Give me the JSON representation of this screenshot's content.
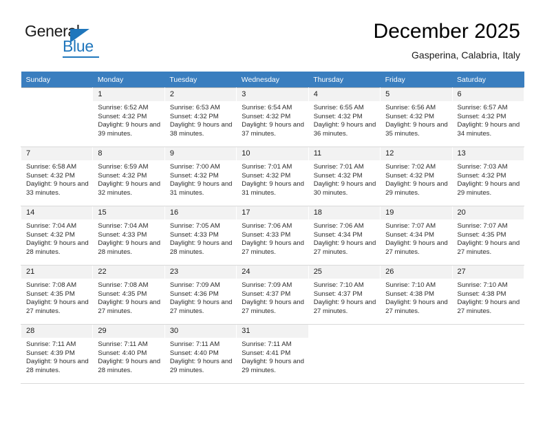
{
  "logo": {
    "line1": "General",
    "line2": "Blue",
    "accent_color": "#1f76bc"
  },
  "header": {
    "title": "December 2025",
    "subtitle": "Gasperina, Calabria, Italy"
  },
  "calendar": {
    "header_color": "#3a7ebf",
    "weekdays": [
      "Sunday",
      "Monday",
      "Tuesday",
      "Wednesday",
      "Thursday",
      "Friday",
      "Saturday"
    ],
    "weeks": [
      [
        {
          "day": "",
          "sunrise": "",
          "sunset": "",
          "daylight": ""
        },
        {
          "day": "1",
          "sunrise": "Sunrise: 6:52 AM",
          "sunset": "Sunset: 4:32 PM",
          "daylight": "Daylight: 9 hours and 39 minutes."
        },
        {
          "day": "2",
          "sunrise": "Sunrise: 6:53 AM",
          "sunset": "Sunset: 4:32 PM",
          "daylight": "Daylight: 9 hours and 38 minutes."
        },
        {
          "day": "3",
          "sunrise": "Sunrise: 6:54 AM",
          "sunset": "Sunset: 4:32 PM",
          "daylight": "Daylight: 9 hours and 37 minutes."
        },
        {
          "day": "4",
          "sunrise": "Sunrise: 6:55 AM",
          "sunset": "Sunset: 4:32 PM",
          "daylight": "Daylight: 9 hours and 36 minutes."
        },
        {
          "day": "5",
          "sunrise": "Sunrise: 6:56 AM",
          "sunset": "Sunset: 4:32 PM",
          "daylight": "Daylight: 9 hours and 35 minutes."
        },
        {
          "day": "6",
          "sunrise": "Sunrise: 6:57 AM",
          "sunset": "Sunset: 4:32 PM",
          "daylight": "Daylight: 9 hours and 34 minutes."
        }
      ],
      [
        {
          "day": "7",
          "sunrise": "Sunrise: 6:58 AM",
          "sunset": "Sunset: 4:32 PM",
          "daylight": "Daylight: 9 hours and 33 minutes."
        },
        {
          "day": "8",
          "sunrise": "Sunrise: 6:59 AM",
          "sunset": "Sunset: 4:32 PM",
          "daylight": "Daylight: 9 hours and 32 minutes."
        },
        {
          "day": "9",
          "sunrise": "Sunrise: 7:00 AM",
          "sunset": "Sunset: 4:32 PM",
          "daylight": "Daylight: 9 hours and 31 minutes."
        },
        {
          "day": "10",
          "sunrise": "Sunrise: 7:01 AM",
          "sunset": "Sunset: 4:32 PM",
          "daylight": "Daylight: 9 hours and 31 minutes."
        },
        {
          "day": "11",
          "sunrise": "Sunrise: 7:01 AM",
          "sunset": "Sunset: 4:32 PM",
          "daylight": "Daylight: 9 hours and 30 minutes."
        },
        {
          "day": "12",
          "sunrise": "Sunrise: 7:02 AM",
          "sunset": "Sunset: 4:32 PM",
          "daylight": "Daylight: 9 hours and 29 minutes."
        },
        {
          "day": "13",
          "sunrise": "Sunrise: 7:03 AM",
          "sunset": "Sunset: 4:32 PM",
          "daylight": "Daylight: 9 hours and 29 minutes."
        }
      ],
      [
        {
          "day": "14",
          "sunrise": "Sunrise: 7:04 AM",
          "sunset": "Sunset: 4:32 PM",
          "daylight": "Daylight: 9 hours and 28 minutes."
        },
        {
          "day": "15",
          "sunrise": "Sunrise: 7:04 AM",
          "sunset": "Sunset: 4:33 PM",
          "daylight": "Daylight: 9 hours and 28 minutes."
        },
        {
          "day": "16",
          "sunrise": "Sunrise: 7:05 AM",
          "sunset": "Sunset: 4:33 PM",
          "daylight": "Daylight: 9 hours and 28 minutes."
        },
        {
          "day": "17",
          "sunrise": "Sunrise: 7:06 AM",
          "sunset": "Sunset: 4:33 PM",
          "daylight": "Daylight: 9 hours and 27 minutes."
        },
        {
          "day": "18",
          "sunrise": "Sunrise: 7:06 AM",
          "sunset": "Sunset: 4:34 PM",
          "daylight": "Daylight: 9 hours and 27 minutes."
        },
        {
          "day": "19",
          "sunrise": "Sunrise: 7:07 AM",
          "sunset": "Sunset: 4:34 PM",
          "daylight": "Daylight: 9 hours and 27 minutes."
        },
        {
          "day": "20",
          "sunrise": "Sunrise: 7:07 AM",
          "sunset": "Sunset: 4:35 PM",
          "daylight": "Daylight: 9 hours and 27 minutes."
        }
      ],
      [
        {
          "day": "21",
          "sunrise": "Sunrise: 7:08 AM",
          "sunset": "Sunset: 4:35 PM",
          "daylight": "Daylight: 9 hours and 27 minutes."
        },
        {
          "day": "22",
          "sunrise": "Sunrise: 7:08 AM",
          "sunset": "Sunset: 4:35 PM",
          "daylight": "Daylight: 9 hours and 27 minutes."
        },
        {
          "day": "23",
          "sunrise": "Sunrise: 7:09 AM",
          "sunset": "Sunset: 4:36 PM",
          "daylight": "Daylight: 9 hours and 27 minutes."
        },
        {
          "day": "24",
          "sunrise": "Sunrise: 7:09 AM",
          "sunset": "Sunset: 4:37 PM",
          "daylight": "Daylight: 9 hours and 27 minutes."
        },
        {
          "day": "25",
          "sunrise": "Sunrise: 7:10 AM",
          "sunset": "Sunset: 4:37 PM",
          "daylight": "Daylight: 9 hours and 27 minutes."
        },
        {
          "day": "26",
          "sunrise": "Sunrise: 7:10 AM",
          "sunset": "Sunset: 4:38 PM",
          "daylight": "Daylight: 9 hours and 27 minutes."
        },
        {
          "day": "27",
          "sunrise": "Sunrise: 7:10 AM",
          "sunset": "Sunset: 4:38 PM",
          "daylight": "Daylight: 9 hours and 27 minutes."
        }
      ],
      [
        {
          "day": "28",
          "sunrise": "Sunrise: 7:11 AM",
          "sunset": "Sunset: 4:39 PM",
          "daylight": "Daylight: 9 hours and 28 minutes."
        },
        {
          "day": "29",
          "sunrise": "Sunrise: 7:11 AM",
          "sunset": "Sunset: 4:40 PM",
          "daylight": "Daylight: 9 hours and 28 minutes."
        },
        {
          "day": "30",
          "sunrise": "Sunrise: 7:11 AM",
          "sunset": "Sunset: 4:40 PM",
          "daylight": "Daylight: 9 hours and 29 minutes."
        },
        {
          "day": "31",
          "sunrise": "Sunrise: 7:11 AM",
          "sunset": "Sunset: 4:41 PM",
          "daylight": "Daylight: 9 hours and 29 minutes."
        },
        {
          "day": "",
          "sunrise": "",
          "sunset": "",
          "daylight": ""
        },
        {
          "day": "",
          "sunrise": "",
          "sunset": "",
          "daylight": ""
        },
        {
          "day": "",
          "sunrise": "",
          "sunset": "",
          "daylight": ""
        }
      ]
    ]
  }
}
